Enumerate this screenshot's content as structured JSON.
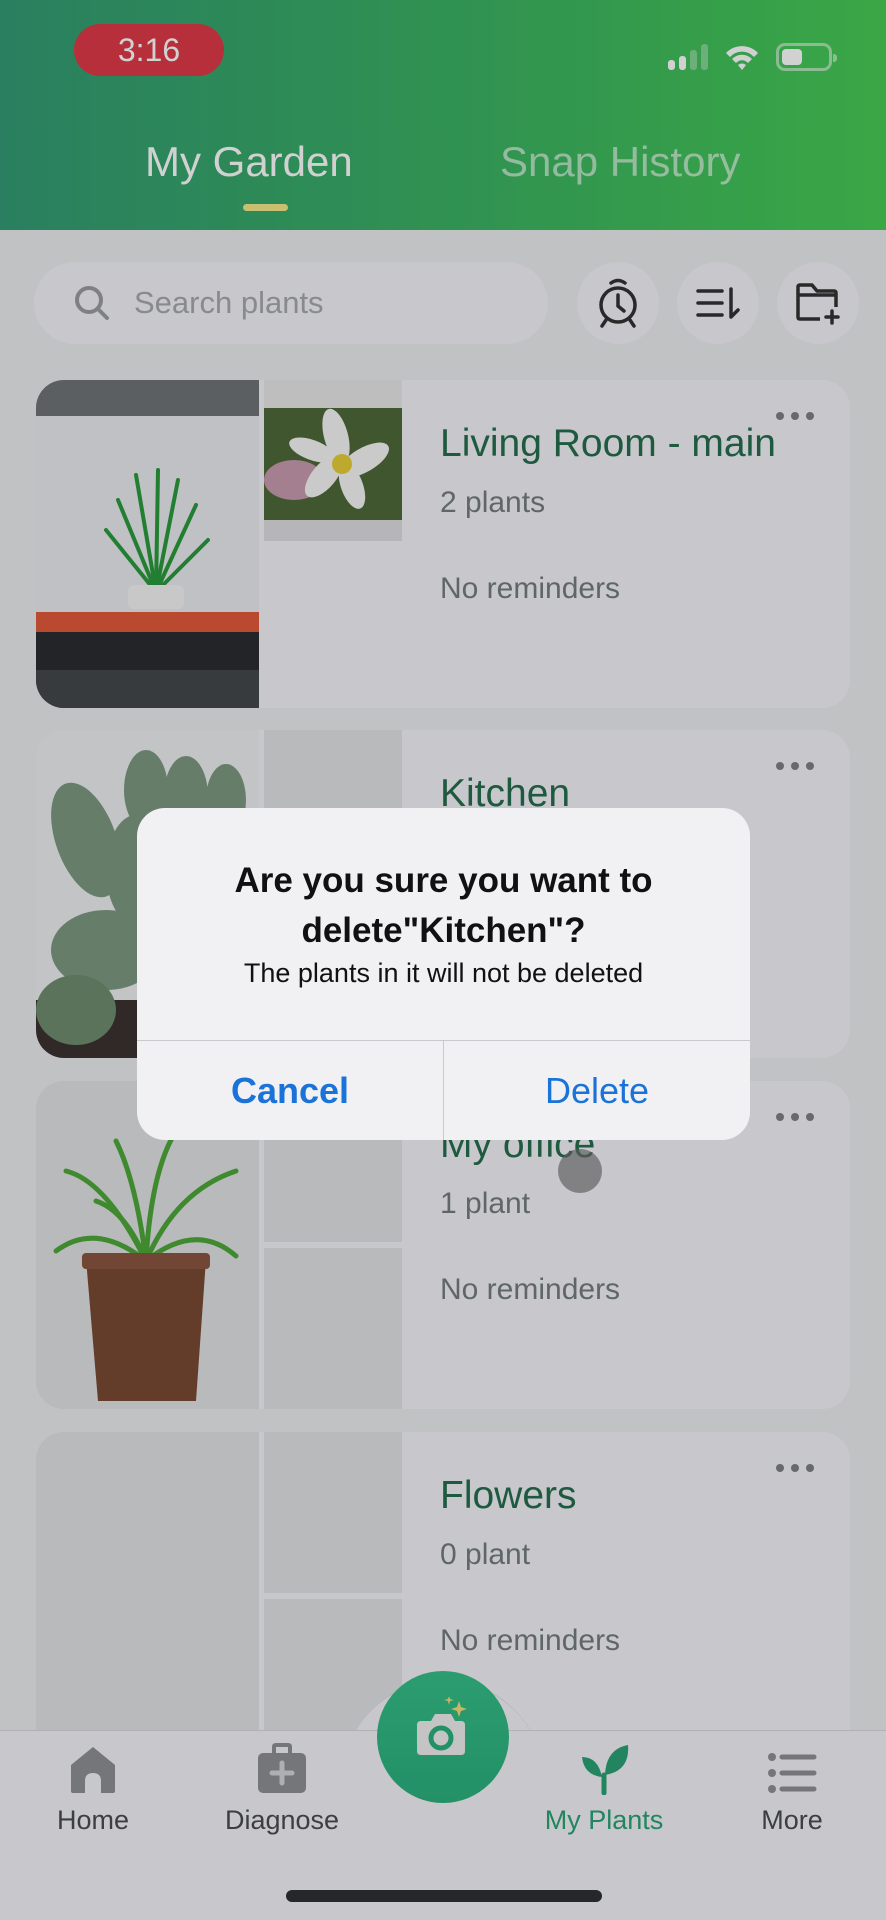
{
  "status_bar": {
    "time": "3:16",
    "battery_percent": 45,
    "signal_bars_active": 2,
    "signal_bars_total": 4
  },
  "header": {
    "tabs": [
      {
        "label": "My Garden",
        "active": true
      },
      {
        "label": "Snap History",
        "active": false
      }
    ]
  },
  "toolbar": {
    "search_placeholder": "Search plants",
    "buttons": [
      "reminder-alarm",
      "sort",
      "new-folder"
    ]
  },
  "gardens": [
    {
      "name": "Living Room - main",
      "count": "2 plants",
      "reminders": "No reminders",
      "thumbnails": [
        "aloe-plant-photo",
        "white-lily-photo"
      ]
    },
    {
      "name": "Kitchen",
      "count": "",
      "reminders": "",
      "thumbnails": [
        "succulent-photo"
      ]
    },
    {
      "name": "My office",
      "count": "1 plant",
      "reminders": "No reminders",
      "thumbnails": [
        "potted-spider-plant-photo"
      ]
    },
    {
      "name": "Flowers",
      "count": "0 plant",
      "reminders": "No reminders",
      "thumbnails": []
    }
  ],
  "bottom_nav": {
    "items": [
      {
        "label": "Home",
        "icon": "home-icon",
        "active": false
      },
      {
        "label": "Diagnose",
        "icon": "first-aid-kit-icon",
        "active": false
      },
      {
        "label": "My Plants",
        "icon": "sprout-icon",
        "active": true
      },
      {
        "label": "More",
        "icon": "list-icon",
        "active": false
      }
    ],
    "center_action": "camera-icon"
  },
  "dialog": {
    "title": "Are you sure you want to delete\"Kitchen\"?",
    "message": "The plants in it will not be deleted",
    "cancel_label": "Cancel",
    "delete_label": "Delete"
  },
  "colors": {
    "brand_green": "#2aa374",
    "title_green": "#256e4e",
    "dialog_button_blue": "#1a73d9",
    "time_pill_red": "#e03a48",
    "tab_underline": "#f6e98a"
  }
}
